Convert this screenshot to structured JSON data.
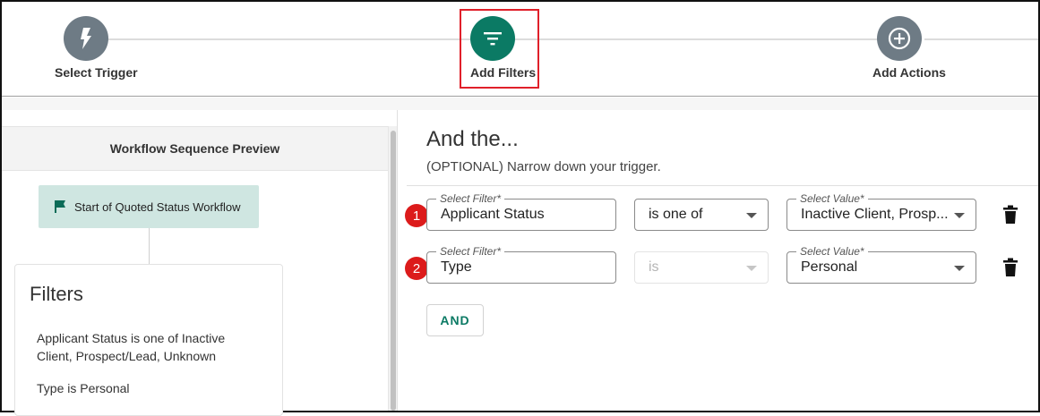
{
  "stepper": {
    "steps": [
      {
        "label": "Select Trigger",
        "icon": "lightning-icon",
        "state": "completed"
      },
      {
        "label": "Add Filters",
        "icon": "filter-icon",
        "state": "active"
      },
      {
        "label": "Add Actions",
        "icon": "plus-circle-icon",
        "state": "pending"
      }
    ]
  },
  "colors": {
    "accent": "#0b7a64",
    "step_inactive": "#6e7b85",
    "highlight": "#e0202a",
    "badge": "#dc1b1b",
    "node_bg": "#cfe6e1"
  },
  "preview": {
    "header": "Workflow Sequence Preview",
    "start_node": "Start of Quoted Status Workflow",
    "filters_title": "Filters",
    "filter_summaries": [
      "Applicant Status is one of Inactive Client, Prospect/Lead, Unknown",
      "Type is Personal"
    ]
  },
  "main": {
    "heading": "And the...",
    "subheading": "(OPTIONAL) Narrow down your trigger.",
    "filters": [
      {
        "badge": "1",
        "filter_label": "Select Filter*",
        "filter_value": "Applicant Status",
        "operator": "is one of",
        "value_label": "Select Value*",
        "value": "Inactive Client, Prosp..."
      },
      {
        "badge": "2",
        "filter_label": "Select Filter*",
        "filter_value": "Type",
        "operator": "is",
        "value_label": "Select Value*",
        "value": "Personal"
      }
    ],
    "and_button": "AND"
  }
}
